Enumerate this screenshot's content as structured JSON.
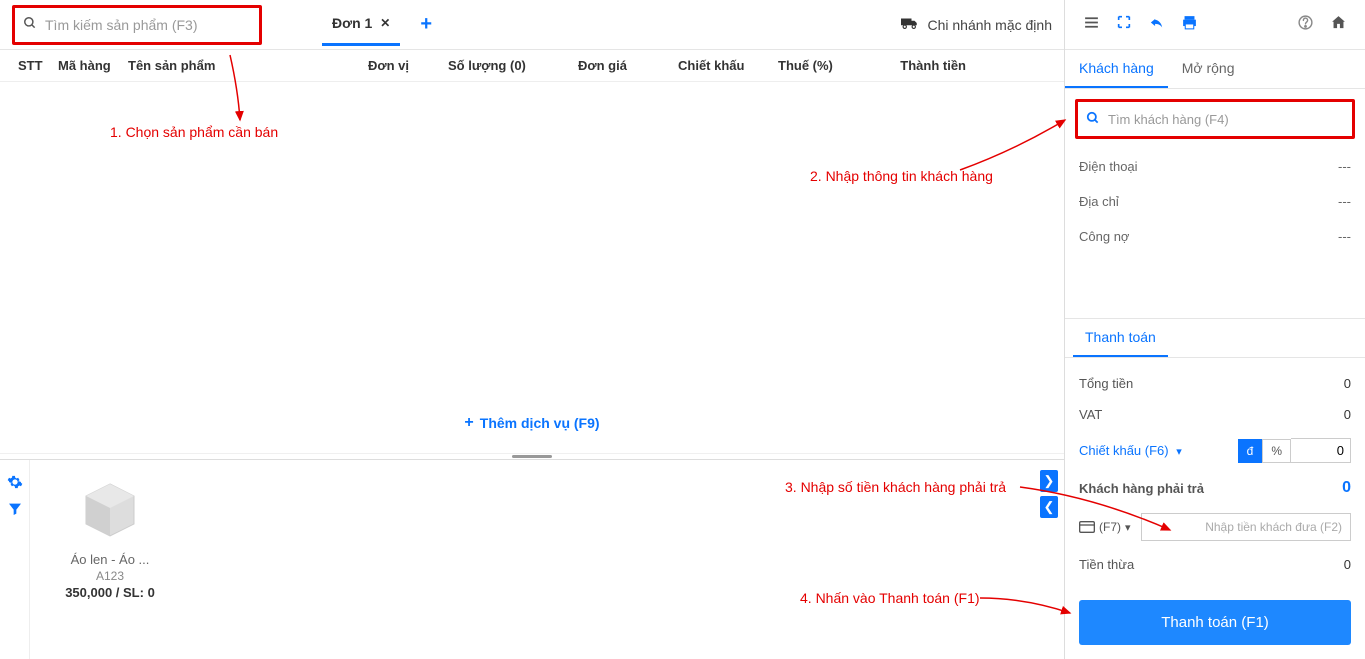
{
  "search": {
    "placeholder": "Tìm kiếm sản phẩm (F3)"
  },
  "tab": {
    "label": "Đơn 1"
  },
  "branch": "Chi nhánh mặc định",
  "columns": {
    "stt": "STT",
    "ma": "Mã hàng",
    "ten": "Tên sản phẩm",
    "dv": "Đơn vị",
    "sl": "Số lượng (0)",
    "dg": "Đơn giá",
    "ck": "Chiết khấu",
    "thue": "Thuế (%)",
    "tt": "Thành tiền"
  },
  "add_service": "Thêm dịch vụ (F9)",
  "product": {
    "name": "Áo len - Áo ...",
    "code": "A123",
    "price_stock": "350,000 / SL: 0"
  },
  "right_tabs": {
    "customer": "Khách hàng",
    "more": "Mở rộng"
  },
  "cust_search": {
    "placeholder": "Tìm khách hàng (F4)"
  },
  "info": {
    "phone_label": "Điện thoại",
    "phone_val": "---",
    "addr_label": "Địa chỉ",
    "addr_val": "---",
    "debt_label": "Công nợ",
    "debt_val": "---"
  },
  "payment": {
    "tab": "Thanh toán",
    "total_label": "Tổng tiền",
    "total_val": "0",
    "vat_label": "VAT",
    "vat_val": "0",
    "discount_label": "Chiết khấu (F6)",
    "discount_btn_d": "đ",
    "discount_btn_pct": "%",
    "discount_val": "0",
    "due_label": "Khách hàng phải trả",
    "due_val": "0",
    "card_label": "(F7)",
    "input_placeholder": "Nhập tiền khách đưa (F2)",
    "change_label": "Tiền thừa",
    "change_val": "0",
    "checkout": "Thanh toán (F1)"
  },
  "annotations": {
    "a1": "1. Chọn sản phẩm cần bán",
    "a2": "2. Nhập thông tin khách hàng",
    "a3": "3. Nhập số tiền khách hàng phải trả",
    "a4": "4. Nhấn vào Thanh toán (F1)"
  }
}
